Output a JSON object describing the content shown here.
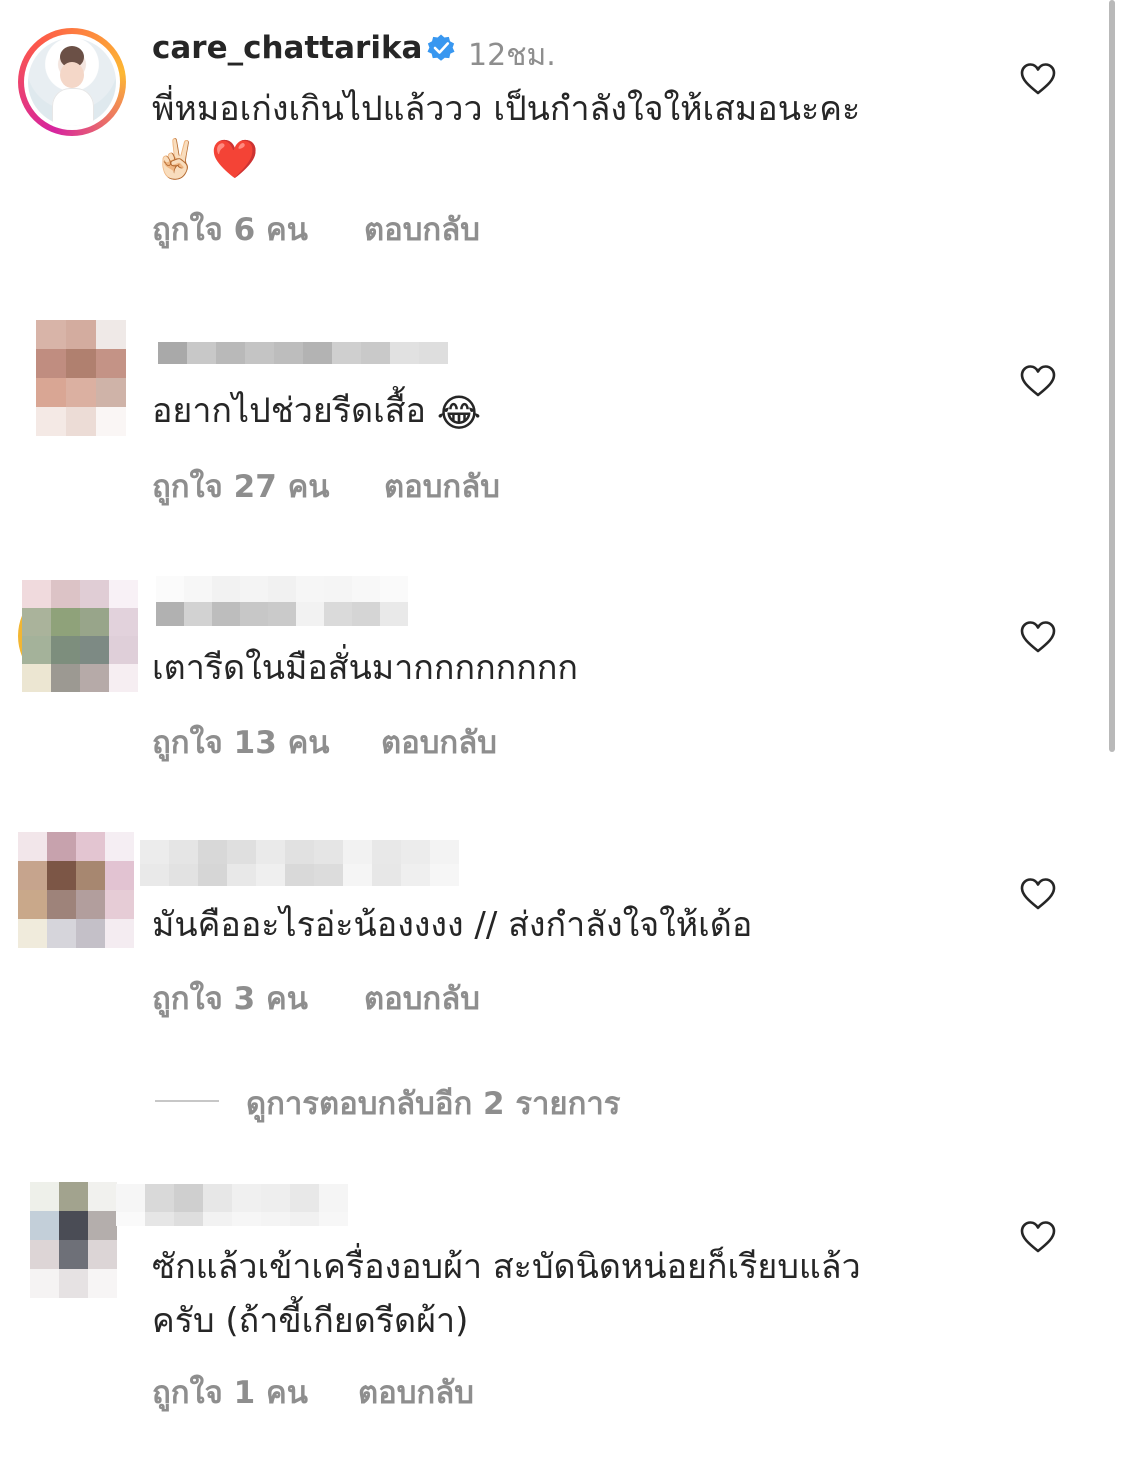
{
  "comments": [
    {
      "username": "care_chattarika",
      "verified": true,
      "time": "12ชม.",
      "text_line1": "พี่หมอเก่งเกินไปแล้ววว เป็นกำลังใจให้เสมอนะคะ",
      "text_line2_emoji": "✌🏻 ❤️",
      "likes": "ถูกใจ 6 คน",
      "reply": "ตอบกลับ"
    },
    {
      "text_line1": "อยากไปช่วยรีดเสื้อ",
      "emoji": "😂",
      "likes": "ถูกใจ 27 คน",
      "reply": "ตอบกลับ"
    },
    {
      "text_line1": "เตารีดในมือสั่นมากกกกกกกก",
      "likes": "ถูกใจ 13 คน",
      "reply": "ตอบกลับ"
    },
    {
      "text_line1": "มันคืออะไรอ่ะน้องงงง // ส่งกำลังใจให้เด้อ",
      "likes": "ถูกใจ 3 คน",
      "reply": "ตอบกลับ"
    },
    {
      "text_line1": "ซักแล้วเข้าเครื่องอบผ้า สะบัดนิดหน่อยก็เรียบแล้ว",
      "text_line2": "ครับ (ถ้าขี้เกียดรีดผ้า)",
      "likes": "ถูกใจ 1 คน",
      "reply": "ตอบกลับ"
    }
  ],
  "view_more_replies": "ดูการตอบกลับอีก 2 รายการ",
  "icons": {
    "heart": "heart-outline-icon",
    "verified": "verified-badge-icon"
  },
  "colors": {
    "text": "#262626",
    "secondary": "#8e8e8e",
    "verified": "#3897f0"
  }
}
